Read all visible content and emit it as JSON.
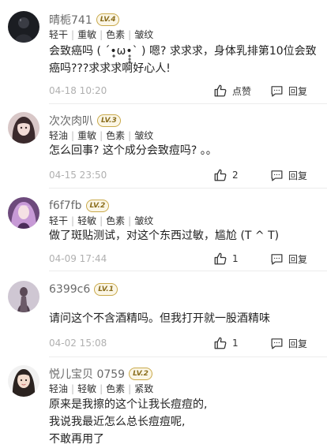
{
  "comments": [
    {
      "username": "晴栀741",
      "level": "LV.4",
      "tags": [
        "轻干",
        "重敏",
        "色素",
        "皱纹"
      ],
      "text_lines": [
        "会致癌吗 ( ´•̥̥̥ω•̥̥̥` ) 嗯? 求求求，身体乳排第10位会致",
        "癌吗???求求求啊好心人!"
      ],
      "date": "04-18 10:20",
      "like_label": "点赞",
      "reply_label": "回复"
    },
    {
      "username": "次次肉叭",
      "level": "LV.3",
      "tags": [
        "轻油",
        "重敏",
        "色素",
        "皱纹"
      ],
      "text_lines": [
        "怎么回事? 这个成分会致痘吗? 。。"
      ],
      "date": "04-15 23:50",
      "like_label": "2",
      "reply_label": "回复"
    },
    {
      "username": "f6f7fb",
      "level": "LV.2",
      "tags": [
        "轻干",
        "轻敏",
        "色素",
        "皱纹"
      ],
      "text_lines": [
        "做了斑贴测试，对这个东西过敏，尴尬 (T ^ T)"
      ],
      "date": "04-09 17:44",
      "like_label": "1",
      "reply_label": "回复"
    },
    {
      "username": "6399c6",
      "level": "LV.1",
      "tags": [],
      "text_lines": [
        "请问这个不含酒精吗。但我打开就一股酒精味"
      ],
      "date": "04-02 15:08",
      "like_label": "1",
      "reply_label": "回复"
    },
    {
      "username": "悦儿宝贝 0759",
      "level": "LV.2",
      "tags": [
        "轻油",
        "轻敏",
        "色素",
        "紧致"
      ],
      "text_lines": [
        "原来是我擦的这个让我长痘痘的,",
        "我说我最近怎么总长痘痘呢,",
        "不敢再用了"
      ],
      "date": "",
      "like_label": "",
      "reply_label": ""
    }
  ]
}
